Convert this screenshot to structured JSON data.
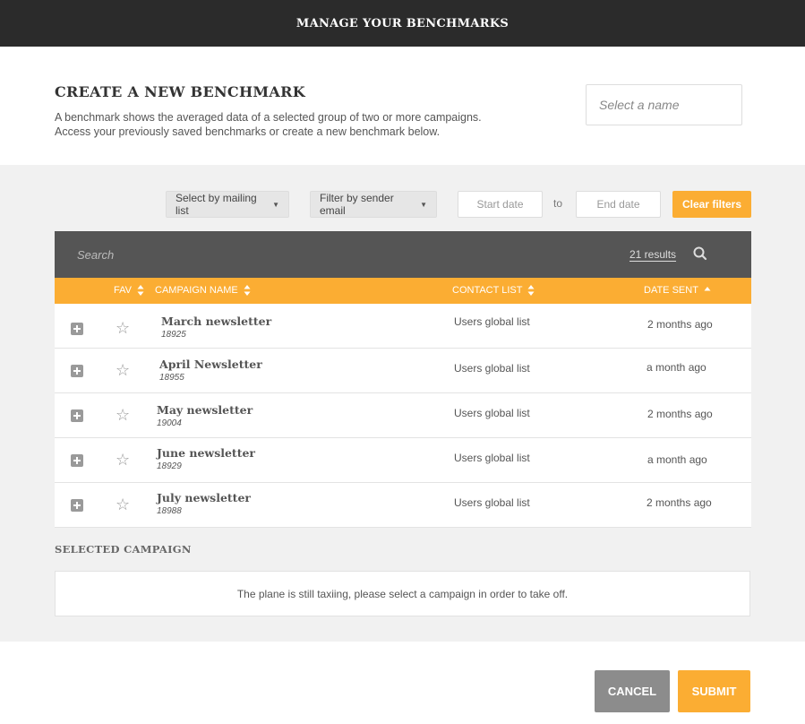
{
  "header": {
    "title": "MANAGE YOUR BENCHMARKS"
  },
  "create": {
    "title": "CREATE A NEW BENCHMARK",
    "description_line1": "A benchmark shows the averaged data of a selected group of two or more campaigns.",
    "description_line2": "Access your previously saved benchmarks or create a new benchmark below.",
    "name_placeholder": "Select a name"
  },
  "filters": {
    "mailing_list": "Select by mailing list",
    "sender_email": "Filter by sender email",
    "start_date": "Start date",
    "to": "to",
    "end_date": "End date",
    "clear": "Clear filters"
  },
  "table": {
    "search_placeholder": "Search",
    "results": "21 results",
    "columns": {
      "fav": "FAV",
      "campaign_name": "CAMPAIGN NAME",
      "contact_list": "CONTACT LIST",
      "date_sent": "DATE SENT"
    },
    "rows": [
      {
        "name": "March newsletter",
        "id": "18925",
        "contact_list": "Users global list",
        "date_sent": "2 months ago"
      },
      {
        "name": "April Newsletter",
        "id": "18955",
        "contact_list": "Users global list",
        "date_sent": "a month ago"
      },
      {
        "name": "May newsletter",
        "id": "19004",
        "contact_list": "Users global list",
        "date_sent": "2 months ago"
      },
      {
        "name": "June newsletter",
        "id": "18929",
        "contact_list": "Users global list",
        "date_sent": "a month ago"
      },
      {
        "name": "July newsletter",
        "id": "18988",
        "contact_list": "Users global list",
        "date_sent": "2 months ago"
      }
    ]
  },
  "selected": {
    "label": "SELECTED CAMPAIGN",
    "empty_message": "The plane is still taxiing, please select a campaign in order to take off."
  },
  "actions": {
    "cancel": "CANCEL",
    "submit": "SUBMIT"
  },
  "colors": {
    "accent": "#fbad33",
    "topbar": "#2b2b2b",
    "search_bar": "#555555",
    "cancel": "#8c8c8c"
  }
}
